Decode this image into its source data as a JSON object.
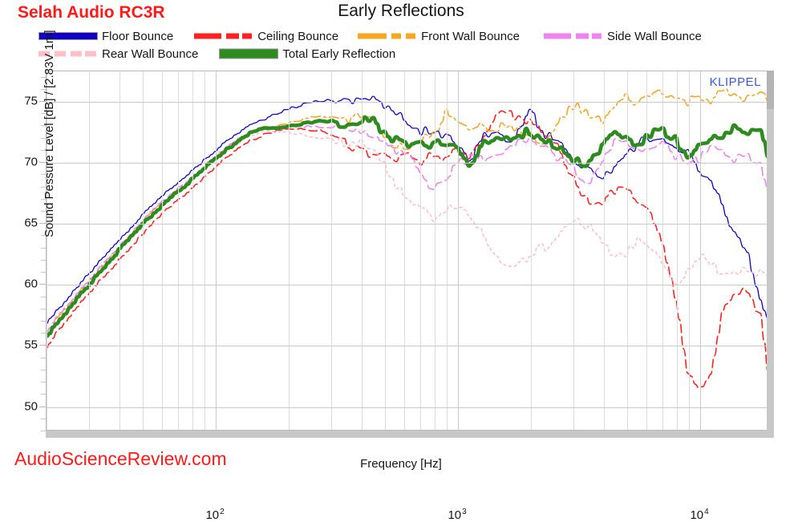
{
  "header": {
    "device_title": "Selah Audio RC3R",
    "chart_title": "Early Reflections",
    "brand_watermark": "AudioScienceReview.com",
    "instrument_watermark": "KLIPPEL"
  },
  "legend": {
    "items": [
      {
        "label": "Floor Bounce",
        "color": "#1000c8",
        "style": "solid",
        "key": "floor"
      },
      {
        "label": "Ceiling Bounce",
        "color": "#ff2020",
        "style": "dashed",
        "key": "ceiling"
      },
      {
        "label": "Front Wall Bounce",
        "color": "#f5a623",
        "style": "dashdot",
        "key": "front"
      },
      {
        "label": "Side Wall Bounce",
        "color": "#ee82ee",
        "style": "dashed",
        "key": "side"
      },
      {
        "label": "Rear Wall Bounce",
        "color": "#ffc0cb",
        "style": "dotted",
        "key": "rear"
      },
      {
        "label": "Total Early Reflection",
        "color": "#2e8b20",
        "style": "solid-thick",
        "key": "total"
      }
    ]
  },
  "axes": {
    "y_title": "Sound Pessure Level [dB] / [2.83V 1m]",
    "x_title": "Frequency [Hz]",
    "y_ticks": [
      "50",
      "55",
      "60",
      "65",
      "70",
      "75"
    ],
    "x_ticks": [
      {
        "base": "10",
        "exp": "2"
      },
      {
        "base": "10",
        "exp": "3"
      },
      {
        "base": "10",
        "exp": "4"
      }
    ]
  },
  "chart_data": {
    "type": "line",
    "title": "Early Reflections",
    "subtitle": "Selah Audio RC3R",
    "xlabel": "Frequency [Hz]",
    "ylabel": "Sound Pessure Level [dB] / [2.83V 1m]",
    "xscale": "log",
    "xlim": [
      20,
      20000
    ],
    "ylim": [
      48,
      77.5
    ],
    "grid": true,
    "legend_position": "top",
    "x": [
      20,
      22,
      25,
      28,
      32,
      36,
      40,
      45,
      50,
      56,
      63,
      71,
      80,
      90,
      100,
      112,
      125,
      140,
      160,
      180,
      200,
      224,
      250,
      280,
      315,
      355,
      400,
      450,
      500,
      560,
      630,
      710,
      800,
      900,
      1000,
      1120,
      1250,
      1400,
      1600,
      1800,
      2000,
      2240,
      2500,
      2800,
      3150,
      3550,
      4000,
      4500,
      5000,
      5600,
      6300,
      7100,
      8000,
      9000,
      10000,
      11200,
      12500,
      14000,
      16000,
      18000,
      20000
    ],
    "series": [
      {
        "name": "Floor Bounce",
        "color": "#1000c8",
        "style": "solid",
        "values": [
          56.8,
          57.8,
          59.0,
          60.2,
          61.5,
          62.6,
          63.6,
          64.7,
          65.7,
          66.7,
          67.6,
          68.5,
          69.3,
          70.2,
          71.0,
          71.8,
          72.5,
          73.1,
          73.6,
          74.0,
          74.4,
          74.7,
          75.0,
          75.1,
          75.2,
          75.0,
          75.3,
          75.5,
          74.6,
          74.0,
          73.3,
          72.6,
          72.5,
          72.2,
          71.4,
          70.0,
          72.0,
          72.6,
          71.8,
          72.5,
          74.6,
          72.4,
          72.2,
          71.2,
          70.0,
          69.2,
          69.0,
          69.4,
          70.4,
          71.6,
          72.1,
          71.6,
          71.0,
          70.8,
          69.2,
          68.6,
          66.4,
          64.0,
          62.6,
          58.5,
          56.3
        ]
      },
      {
        "name": "Ceiling Bounce",
        "color": "#ff2020",
        "style": "dashed",
        "values": [
          54.8,
          56.0,
          57.3,
          58.6,
          59.9,
          61.0,
          62.0,
          63.1,
          64.1,
          65.1,
          66.1,
          67.0,
          67.9,
          68.8,
          69.6,
          70.5,
          71.2,
          71.8,
          72.3,
          72.6,
          72.8,
          72.8,
          72.7,
          72.6,
          72.2,
          71.5,
          71.0,
          70.5,
          70.8,
          70.2,
          70.6,
          70.0,
          70.8,
          70.2,
          71.0,
          70.4,
          71.8,
          73.5,
          74.2,
          73.6,
          73.2,
          72.6,
          71.8,
          70.0,
          68.0,
          66.4,
          66.8,
          67.6,
          67.9,
          67.0,
          65.8,
          63.2,
          59.0,
          53.0,
          51.5,
          52.3,
          57.6,
          59.3,
          59.5,
          57.4,
          50.4
        ]
      },
      {
        "name": "Front Wall Bounce",
        "color": "#f5a623",
        "style": "dashdot",
        "values": [
          56.0,
          57.1,
          58.3,
          59.6,
          60.9,
          62.0,
          63.0,
          64.1,
          65.1,
          66.1,
          67.0,
          67.9,
          68.8,
          69.6,
          70.4,
          71.2,
          71.9,
          72.5,
          72.9,
          73.0,
          73.3,
          73.5,
          73.7,
          73.8,
          73.6,
          73.3,
          74.0,
          73.9,
          72.0,
          71.4,
          71.2,
          71.8,
          72.3,
          74.1,
          73.6,
          73.0,
          72.9,
          72.8,
          73.0,
          72.8,
          72.3,
          71.2,
          72.6,
          74.1,
          74.6,
          73.7,
          73.4,
          74.5,
          75.4,
          74.8,
          75.6,
          75.9,
          75.2,
          74.9,
          75.6,
          75.0,
          75.8,
          75.5,
          75.2,
          75.6,
          74.8
        ]
      },
      {
        "name": "Side Wall Bounce",
        "color": "#ee82ee",
        "style": "dashed",
        "values": [
          56.1,
          57.2,
          58.4,
          59.7,
          61.0,
          62.1,
          63.1,
          64.2,
          65.2,
          66.2,
          67.1,
          68.0,
          68.8,
          69.7,
          70.5,
          71.3,
          72.0,
          72.5,
          72.8,
          72.9,
          73.0,
          73.0,
          72.9,
          72.9,
          72.7,
          72.4,
          72.4,
          72.2,
          71.6,
          71.0,
          70.4,
          69.0,
          67.8,
          68.9,
          69.8,
          70.4,
          70.3,
          70.7,
          71.2,
          71.8,
          72.0,
          71.4,
          70.6,
          70.0,
          69.0,
          68.5,
          70.2,
          71.6,
          71.8,
          71.2,
          70.8,
          71.6,
          70.6,
          70.0,
          70.2,
          71.2,
          71.0,
          70.3,
          70.6,
          69.8,
          67.0
        ]
      },
      {
        "name": "Rear Wall Bounce",
        "color": "#ffc0cb",
        "style": "dotted",
        "values": [
          55.8,
          56.9,
          58.1,
          59.4,
          60.7,
          61.8,
          62.8,
          63.9,
          64.9,
          65.9,
          66.8,
          67.7,
          68.6,
          69.4,
          70.2,
          71.0,
          71.7,
          72.2,
          72.6,
          72.6,
          72.5,
          72.3,
          72.1,
          72.0,
          71.8,
          71.6,
          71.7,
          71.0,
          69.8,
          68.2,
          67.0,
          66.1,
          65.4,
          66.2,
          66.5,
          65.6,
          64.4,
          62.8,
          61.6,
          61.7,
          62.4,
          63.0,
          63.2,
          64.6,
          65.4,
          64.6,
          63.4,
          62.4,
          62.6,
          63.5,
          62.8,
          61.8,
          60.0,
          61.2,
          62.4,
          61.8,
          60.8,
          61.0,
          61.1,
          61.0,
          60.9
        ]
      },
      {
        "name": "Total Early Reflection",
        "color": "#2e8b20",
        "style": "solid-thick",
        "values": [
          55.6,
          56.8,
          58.0,
          59.3,
          60.6,
          61.7,
          62.8,
          63.9,
          64.9,
          65.9,
          66.8,
          67.7,
          68.6,
          69.5,
          70.3,
          71.1,
          71.8,
          72.4,
          72.8,
          72.9,
          73.0,
          73.1,
          73.3,
          73.4,
          73.4,
          73.1,
          73.5,
          73.4,
          72.2,
          71.8,
          71.6,
          71.4,
          71.4,
          71.6,
          71.2,
          69.9,
          71.2,
          72.0,
          72.2,
          72.2,
          72.6,
          71.9,
          71.5,
          70.8,
          70.1,
          70.0,
          71.5,
          72.4,
          72.1,
          71.4,
          72.3,
          72.6,
          71.9,
          70.2,
          71.2,
          71.8,
          72.0,
          72.8,
          72.6,
          72.5,
          70.0
        ]
      }
    ]
  }
}
